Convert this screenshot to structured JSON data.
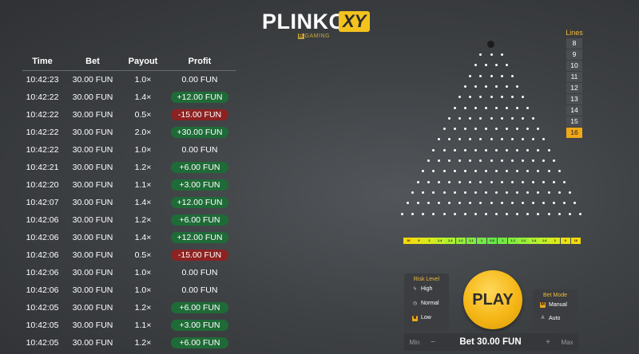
{
  "logo": {
    "plinko": "PLINKO",
    "xy": "XY",
    "gaming_mark": "B",
    "gaming": "GAMING"
  },
  "history": {
    "headers": {
      "time": "Time",
      "bet": "Bet",
      "payout": "Payout",
      "profit": "Profit"
    },
    "rows": [
      {
        "time": "10:42:23",
        "bet": "30.00 FUN",
        "payout": "1.0×",
        "profit": "0.00 FUN",
        "kind": "zero"
      },
      {
        "time": "10:42:22",
        "bet": "30.00 FUN",
        "payout": "1.4×",
        "profit": "+12.00 FUN",
        "kind": "pos"
      },
      {
        "time": "10:42:22",
        "bet": "30.00 FUN",
        "payout": "0.5×",
        "profit": "-15.00 FUN",
        "kind": "neg"
      },
      {
        "time": "10:42:22",
        "bet": "30.00 FUN",
        "payout": "2.0×",
        "profit": "+30.00 FUN",
        "kind": "pos"
      },
      {
        "time": "10:42:22",
        "bet": "30.00 FUN",
        "payout": "1.0×",
        "profit": "0.00 FUN",
        "kind": "zero"
      },
      {
        "time": "10:42:21",
        "bet": "30.00 FUN",
        "payout": "1.2×",
        "profit": "+6.00 FUN",
        "kind": "pos"
      },
      {
        "time": "10:42:20",
        "bet": "30.00 FUN",
        "payout": "1.1×",
        "profit": "+3.00 FUN",
        "kind": "pos"
      },
      {
        "time": "10:42:07",
        "bet": "30.00 FUN",
        "payout": "1.4×",
        "profit": "+12.00 FUN",
        "kind": "pos"
      },
      {
        "time": "10:42:06",
        "bet": "30.00 FUN",
        "payout": "1.2×",
        "profit": "+6.00 FUN",
        "kind": "pos"
      },
      {
        "time": "10:42:06",
        "bet": "30.00 FUN",
        "payout": "1.4×",
        "profit": "+12.00 FUN",
        "kind": "pos"
      },
      {
        "time": "10:42:06",
        "bet": "30.00 FUN",
        "payout": "0.5×",
        "profit": "-15.00 FUN",
        "kind": "neg"
      },
      {
        "time": "10:42:06",
        "bet": "30.00 FUN",
        "payout": "1.0×",
        "profit": "0.00 FUN",
        "kind": "zero"
      },
      {
        "time": "10:42:06",
        "bet": "30.00 FUN",
        "payout": "1.0×",
        "profit": "0.00 FUN",
        "kind": "zero"
      },
      {
        "time": "10:42:05",
        "bet": "30.00 FUN",
        "payout": "1.2×",
        "profit": "+6.00 FUN",
        "kind": "pos"
      },
      {
        "time": "10:42:05",
        "bet": "30.00 FUN",
        "payout": "1.1×",
        "profit": "+3.00 FUN",
        "kind": "pos"
      },
      {
        "time": "10:42:05",
        "bet": "30.00 FUN",
        "payout": "1.2×",
        "profit": "+6.00 FUN",
        "kind": "pos"
      }
    ]
  },
  "board": {
    "rows": 16,
    "slot_multipliers": [
      "16",
      "9",
      "2",
      "1.4",
      "1.4",
      "1.2",
      "1.1",
      "1",
      "0.5",
      "1",
      "1.1",
      "1.2",
      "1.4",
      "1.4",
      "2",
      "9",
      "16"
    ],
    "slot_colors": [
      "#f5d90a",
      "#e9e213",
      "#d9ea1c",
      "#c3ef26",
      "#aef02f",
      "#98ef37",
      "#84ec3e",
      "#74e945",
      "#6ae74a",
      "#74e945",
      "#84ec3e",
      "#98ef37",
      "#aef02f",
      "#c3ef26",
      "#d9ea1c",
      "#e9e213",
      "#f5d90a"
    ]
  },
  "lines": {
    "title": "Lines",
    "options": [
      "8",
      "9",
      "10",
      "11",
      "12",
      "13",
      "14",
      "15",
      "16"
    ],
    "selected": "16"
  },
  "risk": {
    "title": "Risk Level",
    "options": [
      {
        "label": "High",
        "icon": "bolt-icon",
        "selected": false
      },
      {
        "label": "Normal",
        "icon": "clock-icon",
        "selected": false
      },
      {
        "label": "Low",
        "icon": "leaf-icon",
        "selected": true
      }
    ]
  },
  "play": {
    "label": "PLAY"
  },
  "betmode": {
    "title": "Bet Mode",
    "options": [
      {
        "label": "Manual",
        "badge": "M",
        "selected": true
      },
      {
        "label": "Auto",
        "badge": "A",
        "selected": false
      }
    ]
  },
  "bet": {
    "min_label": "Min",
    "dec_label": "−",
    "value": "Bet 30.00 FUN",
    "inc_label": "+",
    "max_label": "Max"
  },
  "colors": {
    "accent": "#f0a718",
    "positive": "#1f6b37",
    "negative": "#8d2222"
  }
}
